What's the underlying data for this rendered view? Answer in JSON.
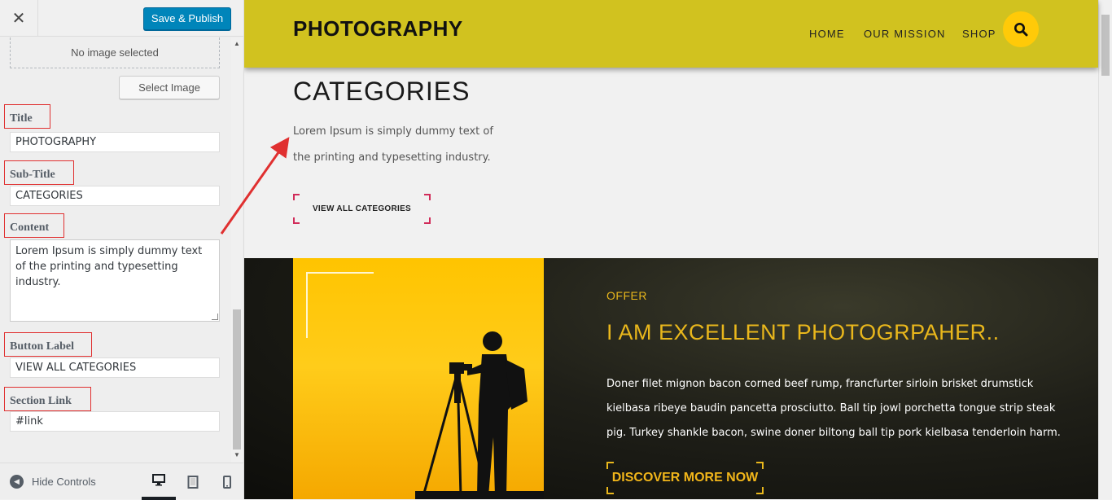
{
  "sidebar": {
    "close_glyph": "✕",
    "publish_label": "Save & Publish",
    "no_image_text": "No image selected",
    "select_image_label": "Select Image",
    "fields": {
      "title_label": "Title",
      "title_value": "PHOTOGRAPHY",
      "subtitle_label": "Sub-Title",
      "subtitle_value": "CATEGORIES",
      "content_label": "Content",
      "content_value": "Lorem Ipsum is simply dummy text of the printing and typesetting industry.",
      "button_label_label": "Button Label",
      "button_label_value": "VIEW ALL CATEGORIES",
      "section_link_label": "Section Link",
      "section_link_value": "#link"
    },
    "footer": {
      "hide_controls_label": "Hide Controls",
      "devices": [
        "desktop-icon",
        "tablet-icon",
        "mobile-icon"
      ]
    }
  },
  "preview": {
    "site_title": "PHOTOGRAPHY",
    "nav": [
      "HOME",
      "OUR MISSION",
      "SHOP"
    ],
    "search_icon": "search-icon",
    "categories": {
      "title": "CATEGORIES",
      "text": "Lorem Ipsum is simply dummy text of the printing and typesetting industry.",
      "button": "VIEW ALL CATEGORIES"
    },
    "offer": {
      "eyebrow": "OFFER",
      "title": "I AM EXCELLENT PHOTOGRPAHER..",
      "text": "Doner filet mignon bacon corned beef rump, francfurter sirloin brisket drumstick kielbasa ribeye baudin pancetta prosciutto. Ball tip jowl porchetta tongue strip steak pig. Turkey shankle bacon, swine doner biltong ball tip pork kielbasa tenderloin harm.",
      "button": "DISCOVER MORE NOW"
    }
  },
  "colors": {
    "header_bg": "#d1c21f",
    "search_bg": "#ffca08",
    "accent_gold": "#e9b71c",
    "publish_blue": "#0085ba",
    "annotation_red": "#e03030",
    "corner_pink": "#d12c5a"
  }
}
